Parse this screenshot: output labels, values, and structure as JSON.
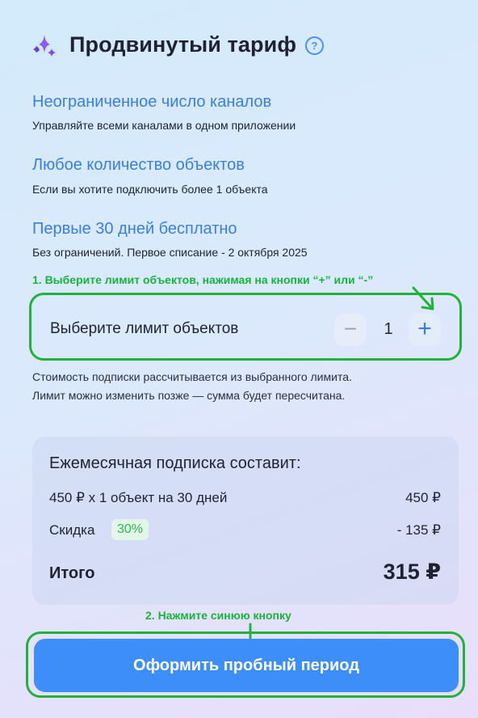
{
  "header": {
    "title": "Продвинутый тариф",
    "icon": "sparkle-icon",
    "help_icon": "question-circle-icon",
    "help_glyph": "?"
  },
  "features": [
    {
      "title": "Неограниченное число каналов",
      "description": "Управляйте всеми каналами в одном приложении"
    },
    {
      "title": "Любое количество объектов",
      "description": "Если вы хотите подключить более 1 объекта"
    },
    {
      "title": "Первые 30 дней бесплатно",
      "description": "Без ограничений. Первое списание - 2 октября 2025"
    }
  ],
  "annotations": {
    "step1": "1. Выберите лимит объектов, нажимая на кнопки “+” или “-”",
    "step2": "2. Нажмите синюю кнопку",
    "color": "#22b23c"
  },
  "stepper": {
    "label": "Выберите лимит объектов",
    "minus": "−",
    "value": "1",
    "plus": "+"
  },
  "note": {
    "line1": "Стоимость подписки рассчитывается из выбранного лимита.",
    "line2": "Лимит можно изменить позже — сумма будет пересчитана."
  },
  "summary": {
    "heading": "Ежемесячная подписка составит:",
    "base_label": "450 ₽ x 1 объект на 30 дней",
    "base_value": "450 ₽",
    "discount_label": "Скидка",
    "discount_badge": "30%",
    "discount_value": "- 135 ₽",
    "total_label": "Итого",
    "total_value": "315 ₽"
  },
  "cta": {
    "label": "Оформить пробный период",
    "color": "#3d8ef8"
  }
}
